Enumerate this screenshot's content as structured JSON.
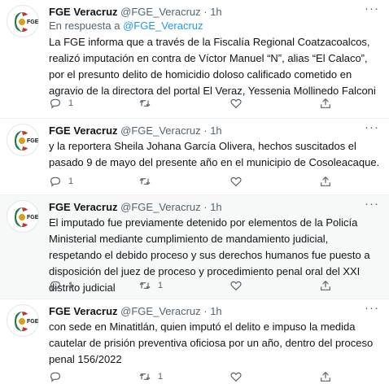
{
  "tweets": [
    {
      "name": "FGE Veracruz",
      "handle": "@FGE_Veracruz",
      "time": "· 1h",
      "reply_prefix": "En respuesta a",
      "reply_mention": "@FGE_Veracruz",
      "text": "La  FGE informa que a través de la Fiscalía Regional Coatzacoalcos, realizó imputación en contra de Víctor Manuel “N”, alias “El Calaco”, por el presunto delito de homicidio doloso calificado cometido en agravio de la directora del portal El Veraz, Yessenia Mollinedo Falconi",
      "reply_count": "1",
      "retweet_count": "",
      "highlighted": false
    },
    {
      "name": "FGE Veracruz",
      "handle": "@FGE_Veracruz",
      "time": "· 1h",
      "text": "y la reporterа Sheila Johana García Olivera, hechos suscitados el pasado 9 de mayo del presente año en el municipio de Cosoleacaque.",
      "reply_count": "1",
      "retweet_count": "",
      "highlighted": false
    },
    {
      "name": "FGE Veracruz",
      "handle": "@FGE_Veracruz",
      "time": "· 1h",
      "text": "El imputado fue previamente detenido por elementos de la Policía Ministerial mediante cumplimiento de mandamiento judicial, respetando el debido proceso y sus derechos humanos fue puesto a disposición del  juez de  proceso  y procedimiento penal oral del XXI distrito judicial",
      "reply_count": "1",
      "retweet_count": "1",
      "highlighted": true
    },
    {
      "name": "FGE Veracruz",
      "handle": "@FGE_Veracruz",
      "time": "· 1h",
      "text": "con sede en Minatitlán, quien imputó el delito e impuso la medida cautelar de prisión preventiva oficiosa por un año, dentro del proceso penal 156/2022",
      "reply_count": "",
      "retweet_count": "1",
      "highlighted": false
    }
  ],
  "avatar_logo_text": "FGE",
  "more_label": "···",
  "icons": {
    "avatar": "fge-logo-icon",
    "reply": "reply-icon",
    "retweet": "retweet-icon",
    "like": "heart-icon",
    "share": "share-icon",
    "more": "more-options-icon"
  },
  "colors": {
    "text": "#0f1419",
    "secondary": "#536471",
    "link": "#1d9bf0",
    "highlight_bg": "#f7f9f9",
    "logo_red": "#c0392b",
    "logo_green": "#1e7b3e"
  }
}
